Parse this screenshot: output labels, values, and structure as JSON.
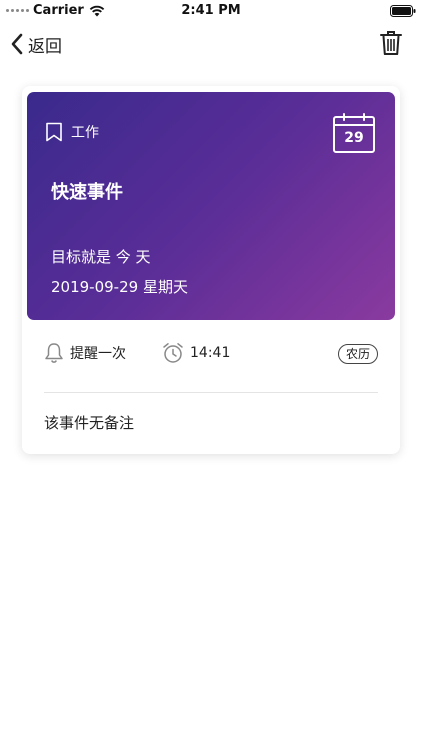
{
  "status_bar": {
    "carrier": "Carrier",
    "time": "2:41 PM"
  },
  "nav": {
    "back_label": "返回"
  },
  "event": {
    "category": "工作",
    "calendar_day": "29",
    "title": "快速事件",
    "goal": "目标就是 今 天",
    "date": "2019-09-29 星期天",
    "reminder": "提醒一次",
    "alarm_time": "14:41",
    "lunar_label": "农历",
    "note": "该事件无备注"
  },
  "colors": {
    "gradient_start": "#3a2a8c",
    "gradient_end": "#8a3a9f"
  }
}
